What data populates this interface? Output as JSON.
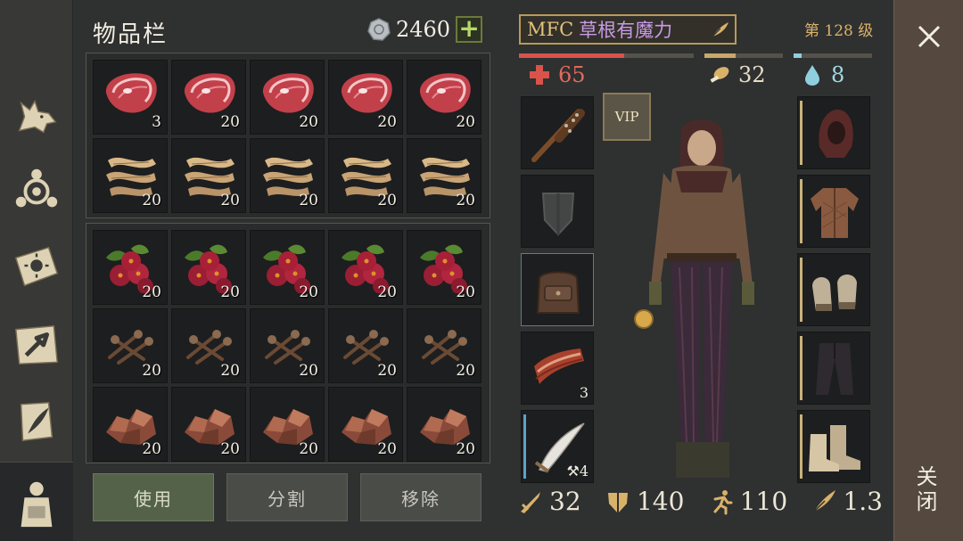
{
  "sidebar": {
    "items": [
      {
        "icon": "wolf-icon"
      },
      {
        "icon": "crafting-icon"
      },
      {
        "icon": "sun-book-icon"
      },
      {
        "icon": "map-arrow-icon"
      },
      {
        "icon": "quill-scroll-icon"
      },
      {
        "icon": "character-backpack-icon"
      }
    ]
  },
  "inventory": {
    "title": "物品栏",
    "coins": "2460",
    "add_label": "+",
    "rows": [
      {
        "icon": "raw-meat-icon",
        "qty": [
          "3",
          "20",
          "20",
          "20",
          "20"
        ]
      },
      {
        "icon": "plant-fiber-icon",
        "qty": [
          "20",
          "20",
          "20",
          "20",
          "20"
        ]
      },
      {
        "icon": "berries-icon",
        "qty": [
          "20",
          "20",
          "20",
          "20",
          "20"
        ]
      },
      {
        "icon": "nails-icon",
        "qty": [
          "20",
          "20",
          "20",
          "20",
          "20"
        ]
      },
      {
        "icon": "copper-ore-icon",
        "qty": [
          "20",
          "20",
          "20",
          "20",
          "20"
        ]
      }
    ],
    "actions": {
      "use": "使用",
      "split": "分割",
      "remove": "移除"
    }
  },
  "character": {
    "tag": "MFC",
    "name": "草根有魔力",
    "level": "第 128 级",
    "health": "65",
    "food": "32",
    "water": "8",
    "health_fill": 0.6,
    "food_fill": 0.4,
    "water_fill": 0.1,
    "vip": "VIP",
    "left_slots": [
      {
        "icon": "spiked-club-icon",
        "qty": ""
      },
      {
        "icon": "shield-placeholder-icon",
        "qty": ""
      },
      {
        "icon": "backpack-icon",
        "qty": ""
      },
      {
        "icon": "bacon-icon",
        "qty": "3"
      },
      {
        "icon": "scimitar-icon",
        "qty": "4"
      }
    ],
    "right_slots": [
      {
        "icon": "hood-icon"
      },
      {
        "icon": "padded-jacket-icon"
      },
      {
        "icon": "gloves-icon"
      },
      {
        "icon": "trousers-icon"
      },
      {
        "icon": "boots-icon"
      }
    ],
    "attack": "32",
    "defense": "140",
    "speed": "110",
    "weight": "1.3"
  },
  "close": {
    "label": "关闭"
  },
  "colors": {
    "health": "#d9534a",
    "food": "#c9a86a",
    "water": "#8fd0de",
    "accent": "#b89b5a"
  }
}
